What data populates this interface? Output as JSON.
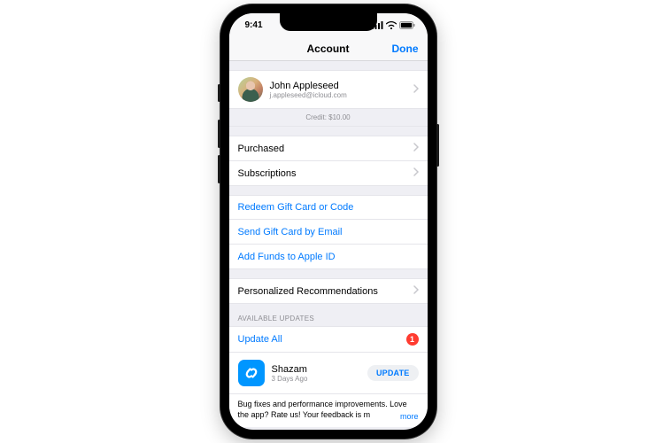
{
  "status": {
    "time": "9:41"
  },
  "nav": {
    "title": "Account",
    "done": "Done"
  },
  "profile": {
    "name": "John Appleseed",
    "email": "j.appleseed@icloud.com",
    "credit": "Credit: $10.00"
  },
  "menu": {
    "purchased": "Purchased",
    "subscriptions": "Subscriptions",
    "redeem": "Redeem Gift Card or Code",
    "send_gift": "Send Gift Card by Email",
    "add_funds": "Add Funds to Apple ID",
    "personalized": "Personalized Recommendations"
  },
  "updates": {
    "header": "AVAILABLE UPDATES",
    "update_all": "Update All",
    "badge": "1",
    "app_name": "Shazam",
    "app_time": "3 Days Ago",
    "update_btn": "UPDATE",
    "notes": "Bug fixes and performance improvements. Love the app? Rate us! Your feedback is m",
    "more": "more"
  }
}
